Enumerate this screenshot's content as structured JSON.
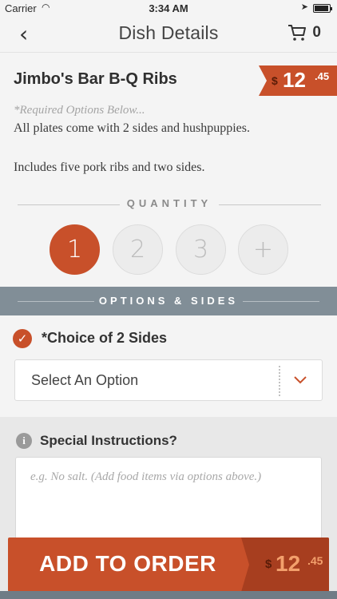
{
  "status_bar": {
    "carrier": "Carrier",
    "time": "3:34 AM"
  },
  "nav": {
    "title": "Dish Details",
    "cart_count": "0"
  },
  "dish": {
    "name": "Jimbo's Bar B-Q Ribs",
    "price_currency": "$",
    "price_dollars": "12",
    "price_cents": ".45",
    "required_note": "*Required Options Below...",
    "description": "All plates come with 2 sides and hushpuppies.",
    "description_2": "Includes five pork ribs and two sides."
  },
  "quantity": {
    "label": "QUANTITY",
    "options": [
      "1",
      "2",
      "3",
      "+"
    ],
    "selected": "1"
  },
  "options": {
    "band_label": "OPTIONS & SIDES",
    "group_title": "*Choice of 2 Sides",
    "select_value": "Select An Option"
  },
  "special": {
    "title": "Special Instructions?",
    "placeholder": "e.g. No salt. (Add food items via options above.)"
  },
  "add_to_order": {
    "label": "ADD TO ORDER",
    "price_currency": "$",
    "price_dollars": "12",
    "price_cents": ".45"
  },
  "colors": {
    "accent": "#c8502a",
    "band": "#818e97"
  }
}
